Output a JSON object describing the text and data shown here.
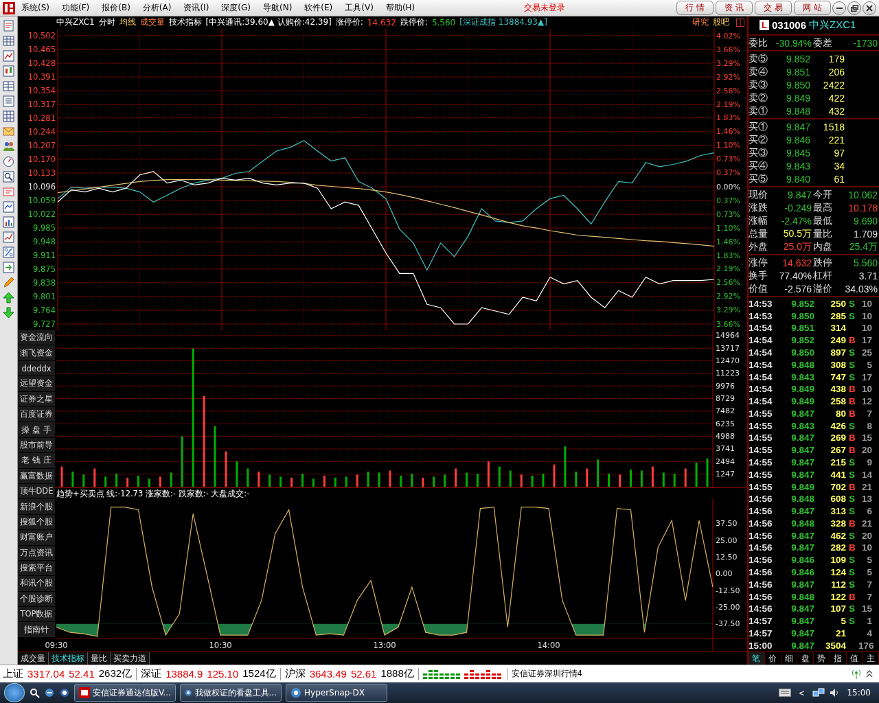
{
  "menu_bar": {
    "items": [
      "系统(S)",
      "功能(F)",
      "报价(B)",
      "分析(A)",
      "资讯(I)",
      "深度(G)",
      "导航(N)",
      "软件(E)",
      "工具(V)",
      "帮助(H)"
    ],
    "login_status": "交易未登录",
    "nav_buttons": [
      "行情",
      "资讯",
      "交易",
      "网站"
    ]
  },
  "chart_header": {
    "security": "中兴ZXC1",
    "items": [
      {
        "text": "分时",
        "kind": "plain"
      },
      {
        "text": "均线",
        "kind": "avg"
      },
      {
        "text": "成交量",
        "kind": "volume"
      },
      {
        "text": "技术指标",
        "kind": "plain"
      },
      {
        "text": "[中兴通讯:39.60▲ 认购价:42.39]",
        "kind": "plain"
      },
      {
        "text": "涨停价:",
        "kind": "plain"
      },
      {
        "text": "14.632",
        "kind": "up"
      },
      {
        "text": "跌停价:",
        "kind": "plain"
      },
      {
        "text": "5.560",
        "kind": "down"
      },
      {
        "text": "[深证成指 13884.93▲]",
        "kind": "index"
      }
    ],
    "links": [
      {
        "text": "研究",
        "kind": "research"
      },
      {
        "text": "股吧",
        "kind": "forum"
      }
    ]
  },
  "price_chart": {
    "pct_labels": [
      {
        "label": "4.02%",
        "color": "#ff4030"
      },
      {
        "label": "3.66%",
        "color": "#ff4030"
      },
      {
        "label": "3.29%",
        "color": "#ff4030"
      },
      {
        "label": "2.92%",
        "color": "#ff4030"
      },
      {
        "label": "2.56%",
        "color": "#ff4030"
      },
      {
        "label": "2.19%",
        "color": "#ff4030"
      },
      {
        "label": "1.83%",
        "color": "#ff4030"
      },
      {
        "label": "1.46%",
        "color": "#ff4030"
      },
      {
        "label": "1.10%",
        "color": "#ff4030"
      },
      {
        "label": "0.73%",
        "color": "#ff4030"
      },
      {
        "label": "0.37%",
        "color": "#ff4030"
      },
      {
        "label": "0.00%",
        "color": "#e0e0e0"
      },
      {
        "label": "0.37%",
        "color": "#30c030"
      },
      {
        "label": "0.73%",
        "color": "#30c030"
      },
      {
        "label": "1.10%",
        "color": "#30c030"
      },
      {
        "label": "1.46%",
        "color": "#30c030"
      },
      {
        "label": "1.83%",
        "color": "#30c030"
      },
      {
        "label": "2.19%",
        "color": "#30c030"
      },
      {
        "label": "2.56%",
        "color": "#30c030"
      },
      {
        "label": "2.92%",
        "color": "#30c030"
      },
      {
        "label": "3.29%",
        "color": "#30c030"
      },
      {
        "label": "3.66%",
        "color": "#30c030"
      }
    ],
    "chart_data": {
      "type": "line",
      "grid": true,
      "ylim": [
        9.727,
        10.502
      ],
      "categories": [
        null,
        null,
        null,
        null,
        null,
        null,
        null,
        null,
        null,
        null,
        null,
        null,
        null,
        null,
        null,
        null,
        null,
        null,
        null,
        null,
        null,
        null,
        null,
        null,
        null,
        null,
        null,
        null,
        null,
        null,
        null,
        null,
        null,
        null,
        null,
        null,
        null,
        null,
        null,
        null,
        null,
        null,
        null,
        null,
        null,
        null,
        null,
        null,
        null
      ],
      "yticks": [
        {
          "value": 10.502,
          "label": "10.502"
        },
        {
          "value": 10.465,
          "label": "10.465"
        },
        {
          "value": 10.428,
          "label": "10.428"
        },
        {
          "value": 10.391,
          "label": "10.391"
        },
        {
          "value": 10.354,
          "label": "10.354"
        },
        {
          "value": 10.317,
          "label": "10.317"
        },
        {
          "value": 10.281,
          "label": "10.281"
        },
        {
          "value": 10.244,
          "label": "10.244"
        },
        {
          "value": 10.207,
          "label": "10.207"
        },
        {
          "value": 10.17,
          "label": "10.170"
        },
        {
          "value": 10.133,
          "label": "10.133"
        },
        {
          "value": 10.096,
          "label": "10.096"
        },
        {
          "value": 10.059,
          "label": "10.059"
        },
        {
          "value": 10.022,
          "label": "10.022"
        },
        {
          "value": 9.985,
          "label": "9.985"
        },
        {
          "value": 9.948,
          "label": "9.948"
        },
        {
          "value": 9.911,
          "label": "9.911"
        },
        {
          "value": 9.875,
          "label": "9.875"
        },
        {
          "value": 9.838,
          "label": "9.838"
        },
        {
          "value": 9.801,
          "label": "9.801"
        },
        {
          "value": 9.764,
          "label": "9.764"
        },
        {
          "value": 9.727,
          "label": "9.727"
        }
      ],
      "series": [
        {
          "color": "#40c0c0",
          "values": [
            10.064,
            10.095,
            10.092,
            10.095,
            10.095,
            10.092,
            10.082,
            10.055,
            10.073,
            10.092,
            10.106,
            10.114,
            10.119,
            10.132,
            10.137,
            10.165,
            10.192,
            10.202,
            10.22,
            10.192,
            10.165,
            10.174,
            10.11,
            10.092,
            10.064,
            9.982,
            9.945,
            9.872,
            9.945,
            9.908,
            9.963,
            10.037,
            10.004,
            10.0,
            10.004,
            10.037,
            10.064,
            10.073,
            10.037,
            9.996,
            10.055,
            10.11,
            10.106,
            10.161,
            10.15,
            10.156,
            10.165,
            10.18,
            10.187
          ]
        },
        {
          "color": "#e0c070",
          "values": [
            10.08,
            10.085,
            10.09,
            10.095,
            10.1,
            10.105,
            10.11,
            10.113,
            10.115,
            10.115,
            10.115,
            10.115,
            10.114,
            10.113,
            10.112,
            10.111,
            10.11,
            10.108,
            10.105,
            10.1,
            10.097,
            10.094,
            10.091,
            10.087,
            10.082,
            10.075,
            10.067,
            10.058,
            10.049,
            10.04,
            10.03,
            10.02,
            10.01,
            10.0,
            9.991,
            9.985,
            9.978,
            9.972,
            9.966,
            9.963,
            9.96,
            9.957,
            9.954,
            9.951,
            9.949,
            9.946,
            9.943,
            9.94,
            9.936
          ]
        },
        {
          "color": "#ffffff",
          "values": [
            10.055,
            10.088,
            10.082,
            10.092,
            10.082,
            10.092,
            10.128,
            10.137,
            10.106,
            10.114,
            10.101,
            10.106,
            10.119,
            10.114,
            10.119,
            10.106,
            10.101,
            10.106,
            10.106,
            10.092,
            10.037,
            10.055,
            10.046,
            9.982,
            9.918,
            9.863,
            9.863,
            9.78,
            9.771,
            9.727,
            9.727,
            9.771,
            9.762,
            9.753,
            9.799,
            9.789,
            9.853,
            9.835,
            9.844,
            9.799,
            9.771,
            9.817,
            9.799,
            9.853,
            9.835,
            9.844,
            9.844,
            9.844,
            9.847
          ]
        }
      ]
    }
  },
  "side_links": [
    "资金流向",
    "渐飞资金",
    "ddeddx",
    "远望资金",
    "证券之星",
    "百度证券",
    "操 盘 手",
    "股市前导",
    "老 钱 庄",
    "赢富数据",
    "顶牛DDE",
    "新浪个股",
    "搜狐个股",
    "财富账户",
    "万点资讯",
    "搜索平台",
    "和讯个股",
    "个股诊断",
    "TOP数据",
    "指南针"
  ],
  "volume_chart": {
    "chart_data": {
      "type": "bar",
      "stacked": true,
      "grid": true,
      "ylim": [
        0,
        15500
      ],
      "yticks": [
        14964,
        13717,
        12470,
        11223,
        9976,
        8729,
        7482,
        6235,
        4988,
        3741,
        2494,
        1247
      ],
      "series": [
        {
          "color": "#ff3c3c",
          "values": [
            2000,
            null,
            null,
            1800,
            null,
            null,
            900,
            null,
            null,
            1000,
            null,
            null,
            null,
            9000,
            null,
            3500,
            null,
            null,
            1500,
            null,
            null,
            900,
            null,
            null,
            1100,
            null,
            null,
            1200,
            null,
            null,
            1600,
            null,
            null,
            900,
            null,
            null,
            1800,
            null,
            null,
            2500,
            null,
            null,
            1200,
            null,
            null,
            2200,
            null,
            null,
            1800,
            null,
            null,
            1200,
            null,
            null,
            2000,
            null,
            null,
            1800,
            null,
            null
          ]
        },
        {
          "color": "#00b000",
          "values": [
            null,
            1500,
            1200,
            null,
            1000,
            1300,
            null,
            1100,
            800,
            null,
            1400,
            5000,
            13700,
            null,
            6000,
            null,
            2500,
            1800,
            null,
            1200,
            1000,
            null,
            1300,
            800,
            null,
            900,
            1000,
            null,
            1500,
            1400,
            null,
            1100,
            1300,
            null,
            1000,
            1200,
            null,
            1400,
            1300,
            null,
            2000,
            1600,
            null,
            1100,
            1300,
            null,
            4000,
            1500,
            null,
            2700,
            1300,
            null,
            1700,
            1600,
            null,
            1400,
            1300,
            null,
            2400,
            2800
          ]
        }
      ]
    }
  },
  "indicator": {
    "title": "趋势+买卖点 线:-12.73 涨家数:- 跌家数:- 大盘成交:-",
    "chart_data": {
      "type": "line",
      "ylim": [
        -58.3,
        56
      ],
      "categories": [
        "09:30",
        null,
        null,
        null,
        null,
        null,
        null,
        null,
        null,
        null,
        null,
        null,
        "10:30",
        null,
        null,
        null,
        null,
        null,
        null,
        null,
        null,
        null,
        null,
        null,
        "13:00",
        null,
        null,
        null,
        null,
        null,
        null,
        null,
        null,
        null,
        null,
        null,
        "14:00",
        null,
        null,
        null,
        null,
        null,
        null,
        null,
        null,
        null,
        null,
        null,
        null
      ],
      "yticks": [
        {
          "value": 37.5,
          "label": "37.50"
        },
        {
          "value": 25,
          "label": "25.00"
        },
        {
          "value": 12.5,
          "label": "12.50"
        },
        {
          "value": 0,
          "label": "0.00"
        },
        {
          "value": -12.5,
          "label": "-12.50"
        },
        {
          "value": -25,
          "label": "-25.00"
        },
        {
          "value": -37.5,
          "label": "-37.50"
        }
      ],
      "series": [
        {
          "color": "#d8b060",
          "values": [
            -40,
            -44,
            -45,
            -47,
            50,
            50,
            48,
            -10,
            -46,
            -30,
            45,
            0,
            -46,
            -46,
            -46,
            -20,
            30,
            48,
            -10,
            -46,
            -45,
            -46,
            -20,
            -5,
            -46,
            -40,
            -10,
            -44,
            -46,
            -46,
            -44,
            49,
            50,
            -40,
            50,
            50,
            49,
            -20,
            -46,
            -46,
            -46,
            49,
            48,
            -44,
            20,
            40,
            -20,
            40,
            -10
          ]
        }
      ]
    }
  },
  "chart_tabs": [
    {
      "label": "成交量",
      "selected": false
    },
    {
      "label": "技术指标",
      "selected": true
    },
    {
      "label": "量比",
      "selected": false
    },
    {
      "label": "买卖力道",
      "selected": false
    }
  ],
  "quote_panel": {
    "badge": "L",
    "code": "031006",
    "name": "中兴ZXC1",
    "ratio": [
      {
        "label": "委比",
        "value": "-30.94%",
        "color": "#30c030"
      },
      {
        "label": "委差",
        "value": "-1730",
        "color": "#30c030"
      }
    ],
    "asks": [
      {
        "label": "卖⑤",
        "price": "9.852",
        "volume": "179"
      },
      {
        "label": "卖④",
        "price": "9.851",
        "volume": "206"
      },
      {
        "label": "卖③",
        "price": "9.850",
        "volume": "2422"
      },
      {
        "label": "卖②",
        "price": "9.849",
        "volume": "422"
      },
      {
        "label": "卖①",
        "price": "9.848",
        "volume": "432"
      }
    ],
    "bids": [
      {
        "label": "买①",
        "price": "9.847",
        "volume": "1518"
      },
      {
        "label": "买②",
        "price": "9.846",
        "volume": "221"
      },
      {
        "label": "买③",
        "price": "9.845",
        "volume": "97"
      },
      {
        "label": "买④",
        "price": "9.843",
        "volume": "34"
      },
      {
        "label": "买⑤",
        "price": "9.840",
        "volume": "61"
      }
    ],
    "stats": [
      [
        {
          "label": "现价",
          "value": "9.847",
          "color": "#30c030"
        },
        {
          "label": "今开",
          "value": "10.062",
          "color": "#30c030"
        }
      ],
      [
        {
          "label": "涨跌",
          "value": "-0.249",
          "color": "#30c030"
        },
        {
          "label": "最高",
          "value": "10.178",
          "color": "#ff4030"
        }
      ],
      [
        {
          "label": "涨幅",
          "value": "-2.47%",
          "color": "#30c030"
        },
        {
          "label": "最低",
          "value": "9.690",
          "color": "#30c030"
        }
      ],
      [
        {
          "label": "总量",
          "value": "50.5万",
          "color": "#ffff60"
        },
        {
          "label": "量比",
          "value": "1.709",
          "color": "#e0e0e0"
        }
      ],
      [
        {
          "label": "外盘",
          "value": "25.0万",
          "color": "#ff4030"
        },
        {
          "label": "内盘",
          "value": "25.4万",
          "color": "#30c030"
        }
      ]
    ],
    "limits": [
      [
        {
          "label": "涨停",
          "value": "14.632",
          "color": "#ff4030"
        },
        {
          "label": "跌停",
          "value": "5.560",
          "color": "#30c030"
        }
      ],
      [
        {
          "label": "换手",
          "value": "77.40%",
          "color": "#e0e0e0"
        },
        {
          "label": "杠杆",
          "value": "3.71",
          "color": "#e0e0e0"
        }
      ],
      [
        {
          "label": "价值",
          "value": "-2.576",
          "color": "#e0e0e0"
        },
        {
          "label": "溢价",
          "value": "34.03%",
          "color": "#e0e0e0"
        }
      ]
    ],
    "trades": [
      {
        "time": "14:53",
        "price": "9.852",
        "volume": "250",
        "side": "S",
        "kind": "sell",
        "count": "10"
      },
      {
        "time": "14:53",
        "price": "9.850",
        "volume": "285",
        "side": "S",
        "kind": "sell",
        "count": "10"
      },
      {
        "time": "14:54",
        "price": "9.851",
        "volume": "314",
        "kind": "neutral",
        "count": "10"
      },
      {
        "time": "14:54",
        "price": "9.852",
        "volume": "249",
        "side": "B",
        "kind": "buy",
        "count": "17"
      },
      {
        "time": "14:54",
        "price": "9.850",
        "volume": "897",
        "side": "S",
        "kind": "sell",
        "count": "25"
      },
      {
        "time": "14:54",
        "price": "9.848",
        "volume": "308",
        "side": "S",
        "kind": "sell",
        "count": "5"
      },
      {
        "time": "14:54",
        "price": "9.843",
        "volume": "747",
        "side": "S",
        "kind": "sell",
        "count": "17"
      },
      {
        "time": "14:54",
        "price": "9.849",
        "volume": "438",
        "side": "B",
        "kind": "buy",
        "count": "10"
      },
      {
        "time": "14:54",
        "price": "9.849",
        "volume": "258",
        "side": "B",
        "kind": "buy",
        "count": "12"
      },
      {
        "time": "14:55",
        "price": "9.847",
        "volume": "80",
        "side": "B",
        "kind": "buy",
        "count": "7"
      },
      {
        "time": "14:55",
        "price": "9.843",
        "volume": "426",
        "side": "S",
        "kind": "sell",
        "count": "8"
      },
      {
        "time": "14:55",
        "price": "9.847",
        "volume": "269",
        "side": "B",
        "kind": "buy",
        "count": "15"
      },
      {
        "time": "14:55",
        "price": "9.847",
        "volume": "267",
        "side": "B",
        "kind": "buy",
        "count": "20"
      },
      {
        "time": "14:55",
        "price": "9.847",
        "volume": "215",
        "side": "S",
        "kind": "sell",
        "count": "9"
      },
      {
        "time": "14:55",
        "price": "9.847",
        "volume": "441",
        "side": "S",
        "kind": "sell",
        "count": "14"
      },
      {
        "time": "14:55",
        "price": "9.849",
        "volume": "702",
        "side": "B",
        "kind": "buy",
        "count": "21"
      },
      {
        "time": "14:56",
        "price": "9.848",
        "volume": "608",
        "side": "S",
        "kind": "sell",
        "count": "13"
      },
      {
        "time": "14:56",
        "price": "9.847",
        "volume": "313",
        "side": "S",
        "kind": "sell",
        "count": "6"
      },
      {
        "time": "14:56",
        "price": "9.848",
        "volume": "328",
        "side": "B",
        "kind": "buy",
        "count": "21"
      },
      {
        "time": "14:56",
        "price": "9.847",
        "volume": "462",
        "side": "S",
        "kind": "sell",
        "count": "20"
      },
      {
        "time": "14:56",
        "price": "9.847",
        "volume": "282",
        "side": "B",
        "kind": "buy",
        "count": "10"
      },
      {
        "time": "14:56",
        "price": "9.846",
        "volume": "109",
        "side": "S",
        "kind": "sell",
        "count": "5"
      },
      {
        "time": "14:56",
        "price": "9.846",
        "volume": "124",
        "side": "S",
        "kind": "sell",
        "count": "5"
      },
      {
        "time": "14:56",
        "price": "9.847",
        "volume": "112",
        "side": "S",
        "kind": "sell",
        "count": "7"
      },
      {
        "time": "14:56",
        "price": "9.848",
        "volume": "122",
        "side": "B",
        "kind": "buy",
        "count": "7"
      },
      {
        "time": "14:56",
        "price": "9.847",
        "volume": "107",
        "side": "S",
        "kind": "sell",
        "count": "15"
      },
      {
        "time": "14:57",
        "price": "9.847",
        "volume": "5",
        "side": "S",
        "kind": "sell",
        "count": "1"
      },
      {
        "time": "14:57",
        "price": "9.847",
        "volume": "21",
        "kind": "neutral",
        "count": "4"
      },
      {
        "time": "15:00",
        "price": "9.847",
        "volume": "3504",
        "kind": "neutral",
        "count": "176"
      }
    ],
    "tabs": [
      {
        "label": "笔",
        "selected": true
      },
      {
        "label": "价",
        "selected": false
      },
      {
        "label": "细",
        "selected": false
      },
      {
        "label": "盘",
        "selected": false
      },
      {
        "label": "势",
        "selected": false
      },
      {
        "label": "指",
        "selected": false
      },
      {
        "label": "值",
        "selected": false
      },
      {
        "label": "主",
        "selected": false
      }
    ]
  },
  "status_bar": {
    "indices": [
      {
        "name": "上证",
        "value": "3317.04",
        "change": "52.41",
        "amount": "2632亿",
        "color": "#e00000"
      },
      {
        "name": "深证",
        "value": "13884.9",
        "change": "125.10",
        "amount": "1524亿",
        "color": "#e00000"
      },
      {
        "name": "沪深",
        "value": "3643.49",
        "change": "52.61",
        "amount": "1888亿",
        "color": "#e00000"
      }
    ],
    "server": "安信证券深圳行情4"
  },
  "taskbar": {
    "tasks": [
      "安信证券通达信版V...",
      "我做权证的看盘工具...",
      "HyperSnap-DX"
    ],
    "tray_toggle": "<",
    "clock": "15:00"
  }
}
